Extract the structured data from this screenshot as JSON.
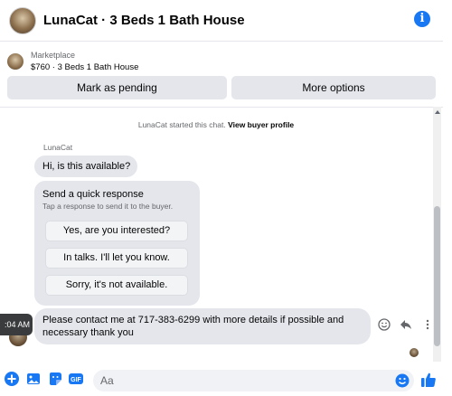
{
  "header": {
    "title": "LunaCat · 3 Beds 1 Bath House",
    "info_icon": "info-icon"
  },
  "listing": {
    "category": "Marketplace",
    "summary": "$760 · 3 Beds 1 Bath House"
  },
  "actions": {
    "mark_pending": "Mark as pending",
    "more_options": "More options"
  },
  "system": {
    "started_text": "LunaCat started this chat.",
    "profile_link": "View buyer profile"
  },
  "chat": {
    "sender_name": "LunaCat",
    "first_message": "Hi, is this available?",
    "quick_response": {
      "title": "Send a quick response",
      "subtitle": "Tap a response to send it to the buyer.",
      "options": [
        "Yes, are you interested?",
        "In talks. I'll let you know.",
        "Sorry, it's not available."
      ]
    },
    "timestamp": ":04 AM",
    "contact_message": "Please contact me at 717-383-6299 with more details if possible and necessary thank you"
  },
  "composer": {
    "placeholder": "Aa",
    "icons": [
      "plus-icon",
      "photo-icon",
      "sticker-icon",
      "gif-icon",
      "emoji-icon",
      "thumbs-up-icon"
    ]
  },
  "colors": {
    "accent": "#1877f2",
    "bubble": "#e4e6eb",
    "tooltip": "#3a3b3c"
  }
}
